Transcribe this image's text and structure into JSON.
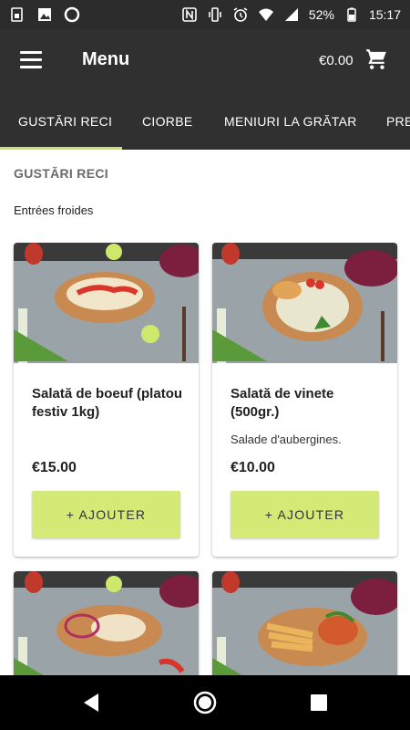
{
  "status_bar": {
    "battery": "52%",
    "time": "15:17",
    "icons": [
      "sim-icon",
      "image-icon",
      "circle-icon",
      "nfc-icon",
      "vibrate-icon",
      "alarm-icon",
      "wifi-icon",
      "signal-icon",
      "battery-icon"
    ]
  },
  "app_bar": {
    "title": "Menu",
    "cart_total": "€0.00"
  },
  "tabs": [
    {
      "label": "GUSTĂRI RECI",
      "active": true
    },
    {
      "label": "CIORBE",
      "active": false
    },
    {
      "label": "MENIURI LA GRĂTAR",
      "active": false
    },
    {
      "label": "PRE",
      "active": false
    }
  ],
  "colors": {
    "accent": "#c6e26a",
    "button": "#d4ea76",
    "app_bar": "#303030"
  },
  "section": {
    "title": "GUSTĂRI RECI",
    "subtitle": "Entrées froides"
  },
  "products": [
    {
      "name": "Salată de boeuf (platou festiv 1kg)",
      "description": "",
      "price": "€15.00",
      "button": "+ AJOUTER"
    },
    {
      "name": "Salată de vinete (500gr.)",
      "description": "Salade d'aubergines.",
      "price": "€10.00",
      "button": "+ AJOUTER"
    },
    {
      "name": "",
      "description": "",
      "price": "",
      "button": ""
    },
    {
      "name": "",
      "description": "",
      "price": "",
      "button": ""
    }
  ]
}
